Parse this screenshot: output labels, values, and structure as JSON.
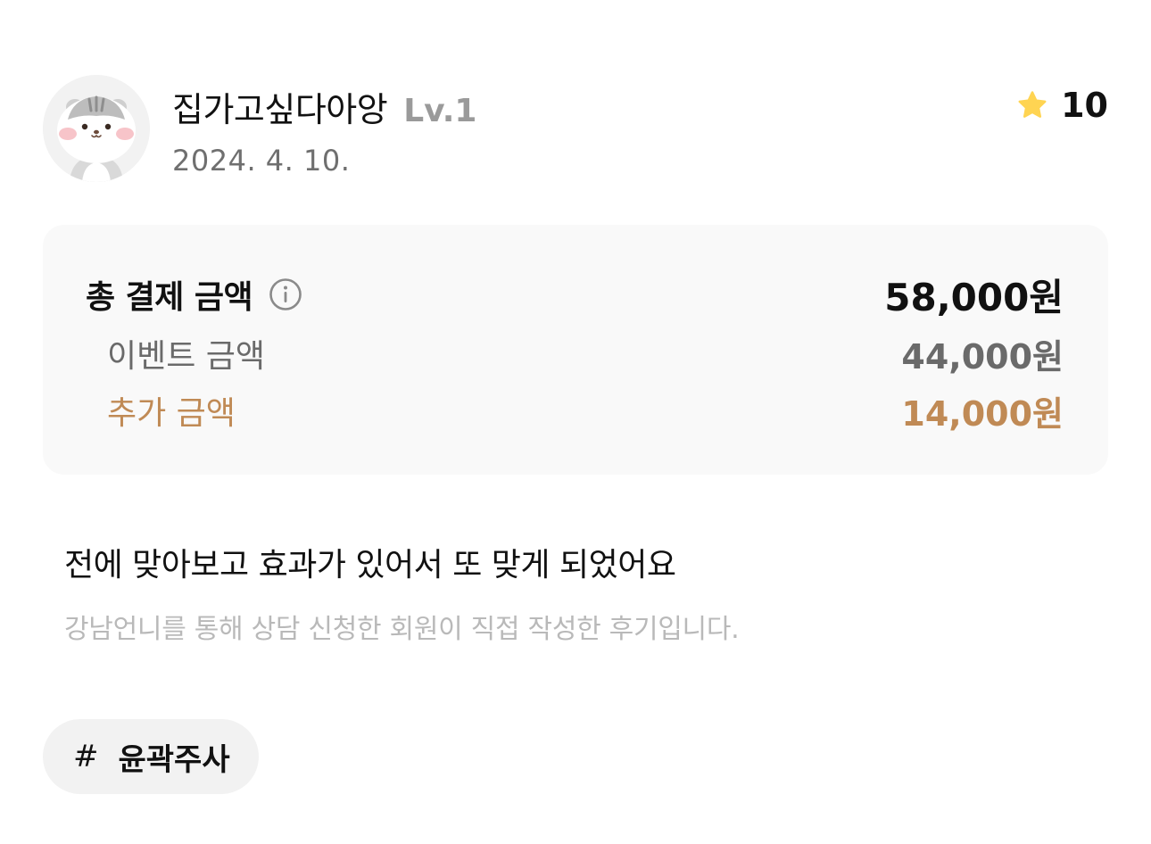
{
  "profile": {
    "nickname": "집가고싶다아앙",
    "level": "Lv.1",
    "date": "2024. 4. 10.",
    "avatar_icon": "hamster-avatar-icon"
  },
  "rating": {
    "icon": "star-icon",
    "value": "10",
    "star_color": "#FFD452"
  },
  "payment": {
    "total_label": "총 결제 금액",
    "total_amount": "58,000원",
    "info_icon": "info-icon",
    "event_label": "이벤트 금액",
    "event_amount": "44,000원",
    "extra_label": "추가 금액",
    "extra_amount": "14,000원",
    "accent_color": "#C08A55"
  },
  "review": {
    "title": "전에 맞아보고 효과가 있어서 또 맞게 되었어요",
    "note": "강남언니를 통해 상담 신청한 회원이 직접 작성한 후기입니다."
  },
  "tags": [
    {
      "hash": "#",
      "label": "윤곽주사"
    }
  ]
}
